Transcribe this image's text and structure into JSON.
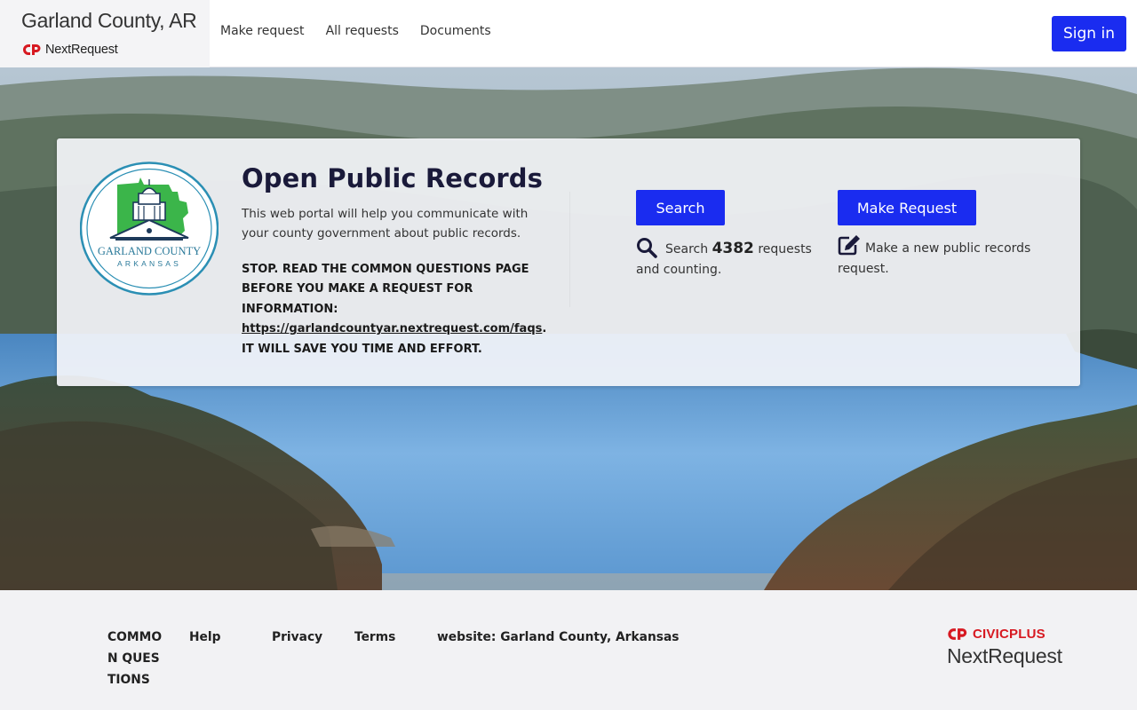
{
  "header": {
    "brand_title": "Garland County, AR",
    "brand_product": "NextRequest",
    "nav": [
      "Make request",
      "All requests",
      "Documents"
    ],
    "signin_label": "Sign in",
    "accent_color": "#1a2cf0"
  },
  "hero": {
    "title": "Open Public Records",
    "description": "This web portal will help you communicate with your county government about public records.",
    "warning_text": "STOP. READ THE COMMON QUESTIONS PAGE BEFORE YOU MAKE A REQUEST FOR INFORMATION:",
    "warning_link": "https://garlandcountyar.nextrequest.com/faqs",
    "warning_suffix": ". IT WILL SAVE YOU TIME AND EFFORT.",
    "seal_top": "GARLAND COUNTY",
    "seal_bottom": "ARKANSAS",
    "search": {
      "button": "Search",
      "prefix": "Search",
      "count": "4382",
      "suffix": "requests and counting.",
      "icon": "search-icon"
    },
    "make_request": {
      "button": "Make Request",
      "text": "Make a new public records request.",
      "icon": "edit-icon"
    }
  },
  "footer": {
    "links": {
      "common_questions": "COMMON QUESTIONS",
      "help": "Help",
      "privacy": "Privacy",
      "terms": "Terms",
      "website": "website: Garland County, Arkansas"
    },
    "civic_top": "CIVICPLUS",
    "civic_bottom": "NextRequest"
  }
}
